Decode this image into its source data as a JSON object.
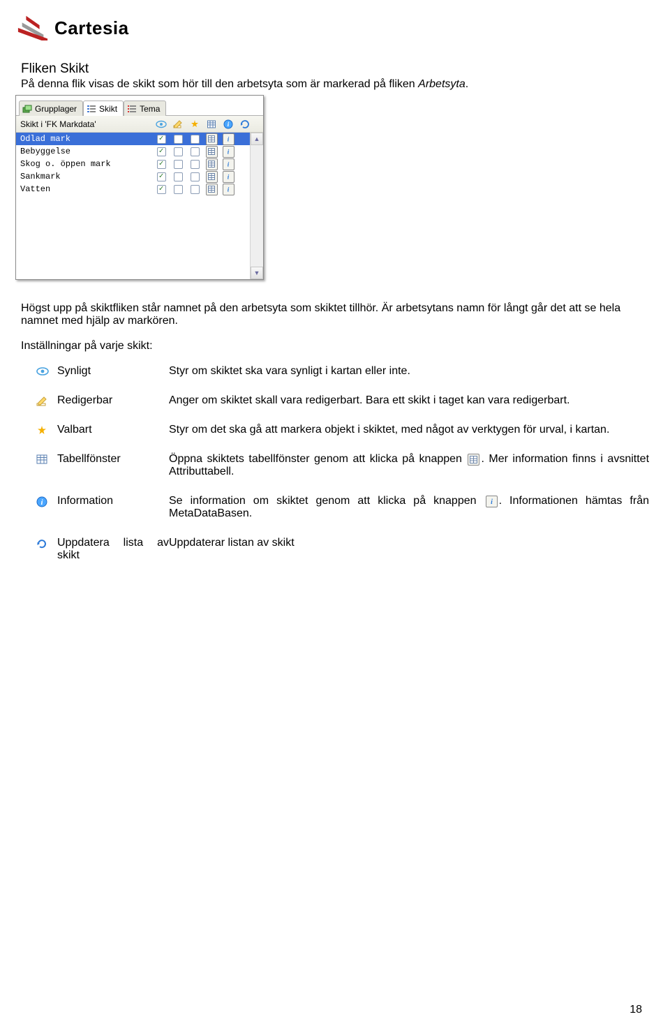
{
  "logo_text": "Cartesia",
  "heading": "Fliken Skikt",
  "intro_prefix": "På denna flik visas de skikt som hör till den arbetsyta som är markerad på fliken ",
  "intro_italic": "Arbetsyta",
  "intro_suffix": ".",
  "panel": {
    "tabs": [
      {
        "label": "Grupplager",
        "active": false
      },
      {
        "label": "Skikt",
        "active": true
      },
      {
        "label": "Tema",
        "active": false
      }
    ],
    "subtitle": "Skikt i 'FK Markdata'",
    "rows": [
      {
        "name": "Odlad mark",
        "selected": true,
        "checked": true
      },
      {
        "name": "Bebyggelse",
        "selected": false,
        "checked": true
      },
      {
        "name": "Skog o. öppen mark",
        "selected": false,
        "checked": true
      },
      {
        "name": "Sankmark",
        "selected": false,
        "checked": true
      },
      {
        "name": "Vatten",
        "selected": false,
        "checked": true
      }
    ]
  },
  "para1": "Högst upp på skiktfliken står namnet på den arbetsyta som skiktet tillhör. Är arbetsytans namn för långt går det att se hela namnet med hjälp av markören.",
  "para2": "Inställningar på varje skikt:",
  "defs": {
    "synligt": {
      "term": "Synligt",
      "desc": "Styr om skiktet ska vara synligt i kartan eller inte."
    },
    "redigerbar": {
      "term": "Redigerbar",
      "desc": "Anger om skiktet skall vara redigerbart. Bara ett skikt i taget kan vara redigerbart."
    },
    "valbart": {
      "term": "Valbart",
      "desc": "Styr om det ska gå att markera objekt i skiktet, med något av verktygen för urval, i kartan."
    },
    "tabell": {
      "term": "Tabellfönster",
      "desc_a": "Öppna skiktets tabellfönster genom att klicka på knappen ",
      "desc_b": ". Mer information finns i avsnittet Attributtabell."
    },
    "info": {
      "term": "Information",
      "desc_a": "Se information om skiktet genom att klicka på knappen ",
      "desc_b": ". Informationen hämtas från MetaDataBasen."
    },
    "uppdatera": {
      "term": "Uppdatera lista av skikt",
      "desc": "Uppdaterar listan av skikt"
    }
  },
  "page_number": "18"
}
